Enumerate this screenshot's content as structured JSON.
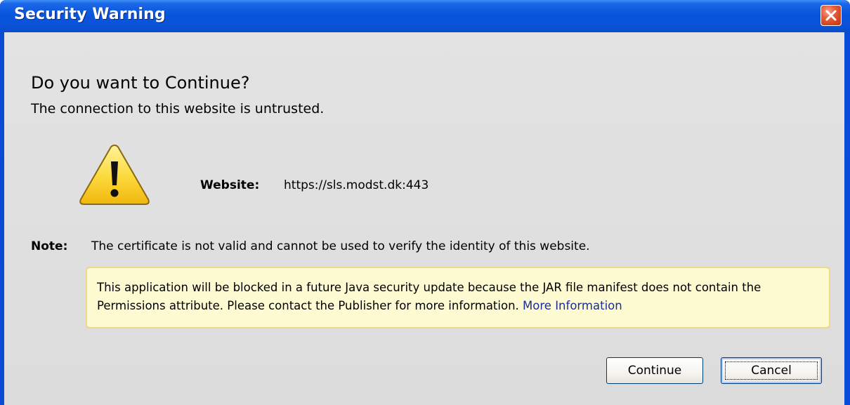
{
  "window": {
    "title": "Security Warning"
  },
  "dialog": {
    "heading": "Do you want to Continue?",
    "subheading": "The connection to this website is untrusted.",
    "website_label": "Website:",
    "website_value": "https://sls.modst.dk:443",
    "note_label": "Note:",
    "note_text": "The certificate is not valid and cannot be used to verify the identity of this website.",
    "info_text": "This application will be blocked in a future Java security update because the JAR file manifest does not contain the Permissions attribute. Please contact the Publisher for more information.",
    "info_link": "More Information"
  },
  "buttons": {
    "continue_label": "Continue",
    "cancel_label": "Cancel"
  },
  "icons": {
    "warning": "warning-triangle-icon",
    "close": "close-icon"
  },
  "colors": {
    "titlebar": "#0a52d8",
    "close_button": "#d4441f",
    "info_background": "#fefbd2",
    "link": "#1a2d9c"
  }
}
